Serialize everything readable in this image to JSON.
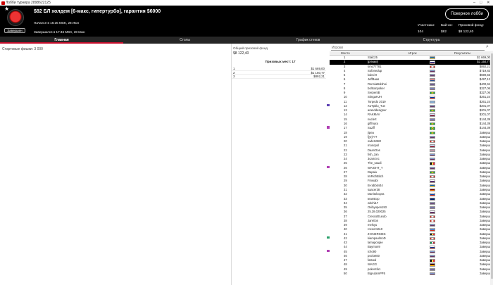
{
  "window": {
    "title": "Лобби турнира 2898622125"
  },
  "header": {
    "title": "$82 БЛ холдем [6-макс, гипертурбо], гарантия $6000",
    "status": "Завершен",
    "start": "Начался в 16:35 MSK, 28 Июн",
    "end": "Завершился в 17:46 MSK, 28 Июн",
    "lobby_button": "Покерное лобби",
    "stats": {
      "players_label": "Участники:",
      "players_value": "104",
      "buyin_label": "Бай-ин:",
      "buyin_value": "$82",
      "prize_label": "Призовой фонд:",
      "prize_value": "$8 122,40"
    }
  },
  "tabs": [
    "Главная",
    "Столы",
    "График стеков",
    "Структура"
  ],
  "main": {
    "starting_chips": "Стартовые фишки: 3 000"
  },
  "prize_panel": {
    "pool_label": "Общий призовой фонд",
    "pool_value": "$8 122,40",
    "places_label": "Призовых мест: 17",
    "rows": [
      {
        "place": "1",
        "amount": "$1 669,00"
      },
      {
        "place": "2",
        "amount": "$1 150,77"
      },
      {
        "place": "3",
        "amount": "$892,21"
      }
    ]
  },
  "players": {
    "search_placeholder": "Игроки",
    "columns": {
      "place": "Место",
      "player": "Игрок",
      "result": "Результаты"
    },
    "rows": [
      {
        "place": "1",
        "name": "Stalc25",
        "result": "$1 669,00",
        "flag": "ua"
      },
      {
        "place": "2",
        "name": "[private]",
        "result": "$1 150,77",
        "flag": "ru"
      },
      {
        "place": "3",
        "name": "smo77781",
        "result": "$892,21",
        "flag": "ca"
      },
      {
        "place": "4",
        "name": "Sofonedup",
        "result": "$719,83",
        "flag": "ru"
      },
      {
        "place": "5",
        "name": "kuksi-0",
        "result": "$590,55",
        "flag": "ru"
      },
      {
        "place": "6",
        "name": "JeffBaas",
        "result": "$497,12",
        "flag": "nl"
      },
      {
        "place": "7",
        "name": "RonniaBolshoi",
        "result": "$400,94",
        "flag": "ru"
      },
      {
        "place": "8",
        "name": "boltsonpoker",
        "result": "$327,06",
        "flag": "ru"
      },
      {
        "place": "9",
        "name": "SerpentB",
        "result": "$327,06",
        "flag": "br"
      },
      {
        "place": "10",
        "name": "StingaHJH",
        "result": "$261,24",
        "flag": "ru"
      },
      {
        "place": "11",
        "name": "Torpedo 2019",
        "result": "$261,24",
        "flag": "gr"
      },
      {
        "place": "12",
        "name": "XuTpblu_Tun",
        "result": "$201,07",
        "flag": "ru"
      },
      {
        "place": "13",
        "name": "aranddesigner",
        "result": "$201,07",
        "flag": "br"
      },
      {
        "place": "14",
        "name": "RAKMAV",
        "result": "$201,07",
        "flag": "ru"
      },
      {
        "place": "15",
        "name": "nuclert",
        "result": "$144,39",
        "flag": "ru"
      },
      {
        "place": "16",
        "name": "giffmyra",
        "result": "$144,39",
        "flag": "br"
      },
      {
        "place": "17",
        "name": "SuZff",
        "result": "$144,39",
        "flag": "br"
      },
      {
        "place": "18",
        "name": "jipea",
        "result": "Заверш",
        "flag": "br"
      },
      {
        "place": "19",
        "name": "fjyrj777",
        "result": "Заверш",
        "flag": "ru"
      },
      {
        "place": "20",
        "name": "owlet1982",
        "result": "Заверш",
        "flag": "ca"
      },
      {
        "place": "21",
        "name": "monopol",
        "result": "Заверш",
        "flag": "ru"
      },
      {
        "place": "22",
        "name": "DaanOos",
        "result": "Заверш",
        "flag": "nl"
      },
      {
        "place": "23",
        "name": "fish_zan",
        "result": "Заверш",
        "flag": "ru"
      },
      {
        "place": "24",
        "name": "3cam.inc",
        "result": "Заверш",
        "flag": "ru"
      },
      {
        "place": "25",
        "name": "The_saudi",
        "result": "Заверш",
        "flag": "be"
      },
      {
        "place": "26",
        "name": "WAIGHT_T",
        "result": "Заверш",
        "flag": "ru"
      },
      {
        "place": "27",
        "name": "Dapaiu",
        "result": "Заверш",
        "flag": "br"
      },
      {
        "place": "28",
        "name": "ImRichBitch",
        "result": "Заверш",
        "flag": "ca"
      },
      {
        "place": "29",
        "name": "Fmwabi",
        "result": "Заверш",
        "flag": "ru"
      },
      {
        "place": "30",
        "name": "B-rabbit444",
        "result": "Заверш",
        "flag": "ua"
      },
      {
        "place": "31",
        "name": "saacer38",
        "result": "Заверш",
        "flag": "de"
      },
      {
        "place": "32",
        "name": "Danitolcopra",
        "result": "Заверш",
        "flag": "ru"
      },
      {
        "place": "33",
        "name": "teamExp",
        "result": "Заверш",
        "flag": "gb"
      },
      {
        "place": "34",
        "name": "witchi17",
        "result": "Заверш",
        "flag": "ru"
      },
      {
        "place": "35",
        "name": "Oxibyopen193",
        "result": "Заверш",
        "flag": "ru"
      },
      {
        "place": "36",
        "name": "25.28.020025",
        "result": "Заверш",
        "flag": "ru"
      },
      {
        "place": "37",
        "name": "CrescotEundo",
        "result": "Заверш",
        "flag": "ca"
      },
      {
        "place": "38",
        "name": "JanKlon",
        "result": "Заверш",
        "flag": "ca"
      },
      {
        "place": "39",
        "name": "melsyu",
        "result": "Заверш",
        "flag": "ru"
      },
      {
        "place": "40",
        "name": "rocoor1610",
        "result": "Заверш",
        "flag": "ru"
      },
      {
        "place": "41",
        "name": "Z-ENERGIES",
        "result": "Заверш",
        "flag": "be"
      },
      {
        "place": "42",
        "name": "kiampaulmoD",
        "result": "Заверш",
        "flag": "ca"
      },
      {
        "place": "43",
        "name": "lamapoopie",
        "result": "Заверш",
        "flag": "it"
      },
      {
        "place": "44",
        "name": "Baymon9",
        "result": "Заверш",
        "flag": "ru"
      },
      {
        "place": "45",
        "name": "icho90",
        "result": "Заверш",
        "flag": "ru"
      },
      {
        "place": "46",
        "name": "pocket00",
        "result": "Заверш",
        "flag": "ru"
      },
      {
        "place": "47",
        "name": "fatsoul",
        "result": "Заверш",
        "flag": "be"
      },
      {
        "place": "48",
        "name": "WAGG",
        "result": "Заверш",
        "flag": "de"
      },
      {
        "place": "49",
        "name": "pokersfu1",
        "result": "Заверш",
        "flag": "ru"
      },
      {
        "place": "50",
        "name": "BigAdamPP5",
        "result": "Заверш",
        "flag": "ru"
      }
    ]
  },
  "colors": {
    "accent": "#c8102e",
    "header_bg": "#000000",
    "tab_bg": "#262626"
  }
}
